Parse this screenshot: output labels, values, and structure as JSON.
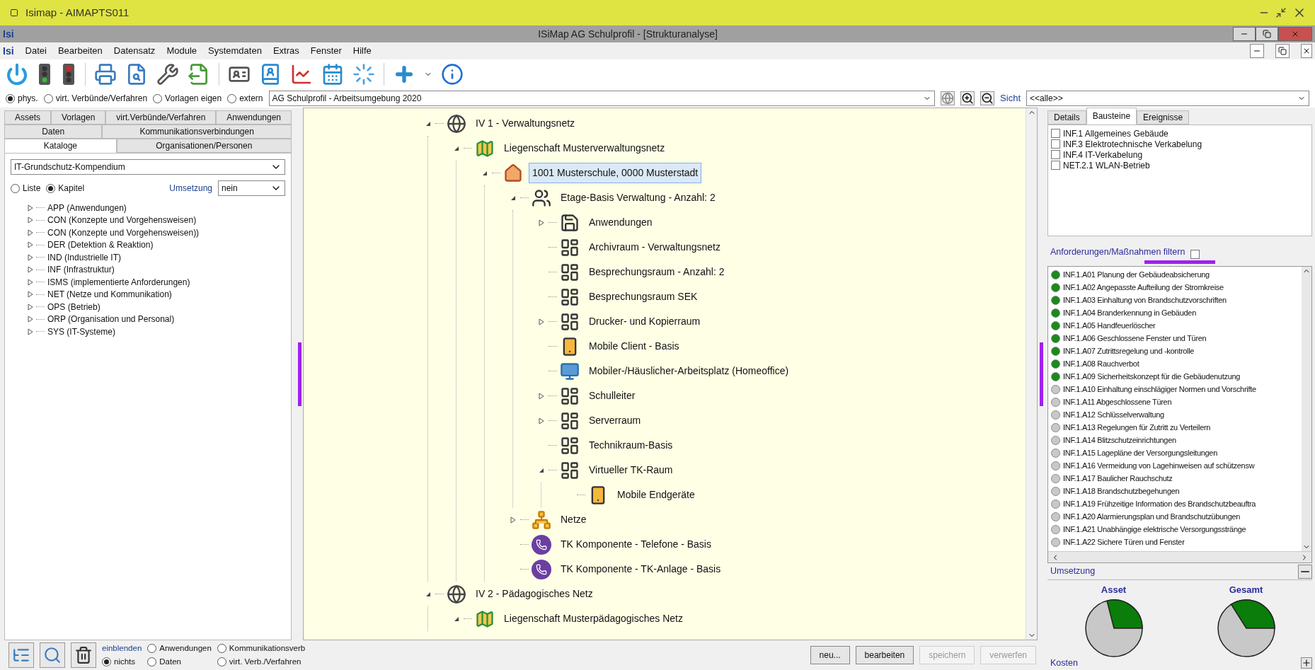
{
  "app_window": {
    "title": "Isimap - AIMAPTS011"
  },
  "document_window": {
    "logo": "Isi",
    "title": "ISiMap AG Schulprofil  - [Strukturanalyse]"
  },
  "menu": {
    "logo": "Isi",
    "items": [
      "Datei",
      "Bearbeiten",
      "Datensatz",
      "Module",
      "Systemdaten",
      "Extras",
      "Fenster",
      "Hilfe"
    ]
  },
  "view_bar": {
    "modes": [
      {
        "label": "phys.",
        "selected": true
      },
      {
        "label": "virt. Verbünde/Verfahren",
        "selected": false
      },
      {
        "label": "Vorlagen eigen",
        "selected": false
      },
      {
        "label": "extern",
        "selected": false
      }
    ],
    "workspace": "AG Schulprofil - Arbeitsumgebung 2020",
    "sicht_label": "Sicht",
    "sicht_value": "<<alle>>"
  },
  "left_panel": {
    "tab_rows": [
      [
        {
          "label": "Assets",
          "selected": false
        },
        {
          "label": "Vorlagen",
          "selected": false
        },
        {
          "label": "virt.Verbünde/Verfahren",
          "selected": false
        },
        {
          "label": "Anwendungen",
          "selected": false
        }
      ],
      [
        {
          "label": "Daten",
          "selected": false
        },
        {
          "label": "Kommunikationsverbindungen",
          "selected": false
        }
      ],
      [
        {
          "label": "Kataloge",
          "selected": true
        },
        {
          "label": "Organisationen/Personen",
          "selected": false
        }
      ]
    ],
    "catalog": "IT-Grundschutz-Kompendium",
    "view_modes": [
      {
        "label": "Liste",
        "selected": false
      },
      {
        "label": "Kapitel",
        "selected": true
      }
    ],
    "umsetzung_label": "Umsetzung",
    "umsetzung_value": "nein",
    "chapters": [
      {
        "label": "APP (Anwendungen)",
        "expanded": false
      },
      {
        "label": "CON (Konzepte und Vorgehensweisen)",
        "expanded": false
      },
      {
        "label": "CON (Konzepte und Vorgehensweisen))",
        "expanded": false
      },
      {
        "label": "DER (Detektion & Reaktion)",
        "expanded": false
      },
      {
        "label": "IND (Industrielle IT)",
        "expanded": false
      },
      {
        "label": "INF (Infrastruktur)",
        "expanded": false
      },
      {
        "label": "ISMS (implementierte Anforderungen)",
        "expanded": false
      },
      {
        "label": "NET (Netze und Kommunikation)",
        "expanded": false
      },
      {
        "label": "OPS (Betrieb)",
        "expanded": false
      },
      {
        "label": "ORP (Organisation und Personal)",
        "expanded": false
      },
      {
        "label": "SYS (IT-Systeme)",
        "expanded": false
      }
    ]
  },
  "tree": [
    {
      "label": "IV 1 - Verwaltungsnetz",
      "kind": "network",
      "expanded": true,
      "selected": false,
      "children": [
        {
          "label": "Liegenschaft Musterverwaltungsnetz",
          "kind": "property",
          "expanded": true,
          "selected": false,
          "children": [
            {
              "label": "1001 Musterschule, 0000 Musterstadt",
              "kind": "building",
              "expanded": true,
              "selected": true,
              "children": [
                {
                  "label": "Etage-Basis Verwaltung - Anzahl: 2",
                  "kind": "floor",
                  "expanded": true,
                  "selected": false,
                  "children": [
                    {
                      "label": "Anwendungen",
                      "kind": "applications",
                      "expanded": false,
                      "selected": false
                    },
                    {
                      "label": "Archivraum - Verwaltungsnetz",
                      "kind": "room",
                      "selected": false
                    },
                    {
                      "label": "Besprechungsraum - Anzahl: 2",
                      "kind": "room",
                      "selected": false
                    },
                    {
                      "label": "Besprechungsraum SEK",
                      "kind": "room",
                      "selected": false
                    },
                    {
                      "label": "Drucker- und Kopierraum",
                      "kind": "room",
                      "expanded": false,
                      "selected": false
                    },
                    {
                      "label": "Mobile Client - Basis",
                      "kind": "mobile",
                      "selected": false
                    },
                    {
                      "label": "Mobiler-/Häuslicher-Arbeitsplatz (Homeoffice)",
                      "kind": "workstation",
                      "selected": false
                    },
                    {
                      "label": "Schulleiter",
                      "kind": "room",
                      "expanded": false,
                      "selected": false
                    },
                    {
                      "label": "Serverraum",
                      "kind": "room",
                      "expanded": false,
                      "selected": false
                    },
                    {
                      "label": "Technikraum-Basis",
                      "kind": "room",
                      "selected": false
                    },
                    {
                      "label": "Virtueller TK-Raum",
                      "kind": "room",
                      "expanded": true,
                      "selected": false,
                      "children": [
                        {
                          "label": "Mobile Endgeräte",
                          "kind": "mobile",
                          "selected": false
                        }
                      ]
                    }
                  ]
                },
                {
                  "label": "Netze",
                  "kind": "networks",
                  "expanded": false,
                  "selected": false
                },
                {
                  "label": "TK Komponente - Telefone - Basis",
                  "kind": "phone",
                  "selected": false
                },
                {
                  "label": "TK Komponente - TK-Anlage - Basis",
                  "kind": "phone",
                  "selected": false
                }
              ]
            }
          ]
        }
      ]
    },
    {
      "label": "IV 2 - Pädagogisches Netz",
      "kind": "network",
      "expanded": true,
      "selected": false,
      "children": [
        {
          "label": "Liegenschaft Musterpädagogisches Netz",
          "kind": "property",
          "expanded": true,
          "selected": false
        }
      ]
    }
  ],
  "bottom_bar": {
    "filter_label": "einblenden",
    "filters": [
      {
        "label": "Anwendungen",
        "selected": false
      },
      {
        "label": "Kommunikationsverb",
        "selected": false
      },
      {
        "label": "nichts",
        "selected": true
      },
      {
        "label": "Daten",
        "selected": false
      },
      {
        "label": "virt. Verb./Verfahren",
        "selected": false
      }
    ],
    "buttons": [
      {
        "label": "neu...",
        "disabled": false
      },
      {
        "label": "bearbeiten",
        "disabled": false
      },
      {
        "label": "speichern",
        "disabled": true
      },
      {
        "label": "verwerfen",
        "disabled": true
      }
    ]
  },
  "right_panel": {
    "tabs": [
      {
        "label": "Details",
        "selected": false
      },
      {
        "label": "Bausteine",
        "selected": true
      },
      {
        "label": "Ereignisse",
        "selected": false
      }
    ],
    "bausteine": [
      {
        "label": "INF.1 Allgemeines Gebäude",
        "checked": false
      },
      {
        "label": "INF.3 Elektrotechnische Verkabelung",
        "checked": false
      },
      {
        "label": "INF.4 IT-Verkabelung",
        "checked": false
      },
      {
        "label": "NET.2.1 WLAN-Betrieb",
        "checked": false
      }
    ],
    "filter_label": "Anforderungen/Maßnahmen filtern",
    "filter_checked": false,
    "requirements": [
      {
        "label": "INF.1.A01 Planung der Gebäudeabsicherung",
        "color": "#1a8a1a"
      },
      {
        "label": "INF.1.A02 Angepasste Aufteilung der Stromkreise",
        "color": "#1a8a1a"
      },
      {
        "label": "INF.1.A03 Einhaltung von Brandschutzvorschriften",
        "color": "#1a8a1a"
      },
      {
        "label": "INF.1.A04 Branderkennung in Gebäuden",
        "color": "#1a8a1a"
      },
      {
        "label": "INF.1.A05 Handfeuerlöscher",
        "color": "#1a8a1a"
      },
      {
        "label": "INF.1.A06 Geschlossene Fenster und Türen",
        "color": "#1a8a1a"
      },
      {
        "label": "INF.1.A07 Zutrittsregelung und -kontrolle",
        "color": "#1a8a1a"
      },
      {
        "label": "INF.1.A08 Rauchverbot",
        "color": "#1a8a1a"
      },
      {
        "label": "INF.1.A09 Sicherheitskonzept für die Gebäudenutzung",
        "color": "#1a8a1a"
      },
      {
        "label": "INF.1.A10 Einhaltung einschlägiger Normen und Vorschrifte",
        "color": "#c8c8c8"
      },
      {
        "label": "INF.1.A11 Abgeschlossene Türen",
        "color": "#c8c8c8"
      },
      {
        "label": "INF.1.A12 Schlüsselverwaltung",
        "color": "#c8c8c8"
      },
      {
        "label": "INF.1.A13 Regelungen für Zutritt zu Verteilern",
        "color": "#c8c8c8"
      },
      {
        "label": "INF.1.A14 Blitzschutzeinrichtungen",
        "color": "#c8c8c8"
      },
      {
        "label": "INF.1.A15 Lagepläne der Versorgungsleitungen",
        "color": "#c8c8c8"
      },
      {
        "label": "INF.1.A16 Vermeidung von Lagehinweisen auf schützensw",
        "color": "#c8c8c8"
      },
      {
        "label": "INF.1.A17 Baulicher Rauchschutz",
        "color": "#c8c8c8"
      },
      {
        "label": "INF.1.A18 Brandschutzbegehungen",
        "color": "#c8c8c8"
      },
      {
        "label": "INF.1.A19 Frühzeitige Information des Brandschutzbeauftra",
        "color": "#c8c8c8"
      },
      {
        "label": "INF.1.A20 Alarmierungsplan und Brandschutzübungen",
        "color": "#c8c8c8"
      },
      {
        "label": "INF.1.A21 Unabhängige elektrische Versorgungsstränge",
        "color": "#c8c8c8"
      },
      {
        "label": "INF.1.A22 Sichere Türen und Fenster",
        "color": "#c8c8c8"
      }
    ],
    "umsetzung_label": "Umsetzung",
    "pies": [
      {
        "title": "Asset"
      },
      {
        "title": "Gesamt"
      }
    ],
    "kosten_label": "Kosten"
  }
}
